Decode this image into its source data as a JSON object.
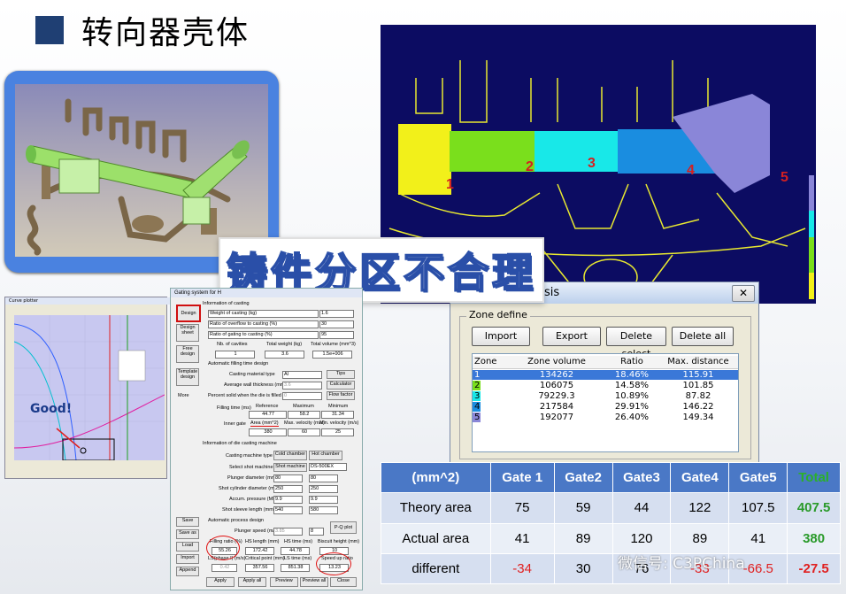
{
  "slide": {
    "title": "转向器壳体",
    "banner": "铸件分区不合理"
  },
  "zone_view": {
    "zone_labels": [
      "1",
      "2",
      "3",
      "4",
      "5"
    ],
    "zone_colors": [
      "#f2f01a",
      "#7adf1c",
      "#18e8e8",
      "#1a8de0",
      "#8a86d8"
    ]
  },
  "zone_dialog": {
    "title_fragment": "sis",
    "group_label": "Zone define",
    "buttons": [
      "Import",
      "Export",
      "Delete select",
      "Delete all"
    ],
    "columns": [
      "Zone",
      "Zone volume",
      "Ratio",
      "Max. distance"
    ],
    "rows": [
      {
        "zone": "1",
        "volume": "134262",
        "ratio": "18.46%",
        "dist": "115.91",
        "color": "#1e6fd6"
      },
      {
        "zone": "2",
        "volume": "106075",
        "ratio": "14.58%",
        "dist": "101.85",
        "color": "#7adf1c"
      },
      {
        "zone": "3",
        "volume": "79229.3",
        "ratio": "10.89%",
        "dist": "87.82",
        "color": "#18e8e8"
      },
      {
        "zone": "4",
        "volume": "217584",
        "ratio": "29.91%",
        "dist": "146.22",
        "color": "#1a8de0"
      },
      {
        "zone": "5",
        "volume": "192077",
        "ratio": "26.40%",
        "dist": "149.34",
        "color": "#8a86d8"
      }
    ]
  },
  "cure_plot": {
    "window_title": "Curve plotter",
    "annotation": "Good!"
  },
  "gating_window": {
    "title": "Gating system for H",
    "side_buttons": [
      "Design",
      "Design sheet",
      "Free design",
      "Template design",
      "More"
    ],
    "bottom_side_buttons": [
      "Save",
      "Save as",
      "Load",
      "Import",
      "Append"
    ],
    "bottom_buttons": [
      "Apply",
      "Apply all",
      "Preview",
      "Preview all",
      "Close"
    ],
    "section_casting": "Information of casting",
    "fields": [
      {
        "label": "Weight of casting (kg)",
        "value": "1.6"
      },
      {
        "label": "Ratio of overflow to casting (%)",
        "value": "30"
      },
      {
        "label": "Ratio of gating to casting (%)",
        "value": "95"
      }
    ],
    "cavities_header": [
      "Nb. of cavities",
      "Total weight (kg)",
      "Total volume (mm^3)"
    ],
    "cavities_values": [
      "1",
      "3.6",
      "1.5e+006"
    ],
    "auto_fill_label": "Automatic filling time design",
    "material_label": "Casting material type",
    "material_value": "Al",
    "tips": "Tips",
    "wall_label": "Average wall thickness (mm)",
    "wall_value": "3.6",
    "calculator": "Calculator",
    "percent_label": "Percent solid when the die is filled (%)",
    "percent_value": "0",
    "flow_factor": "Flow factor",
    "fill_time_label": "Filling time (ms)",
    "fill_cols": [
      "Reference",
      "Maximum",
      "Minimum"
    ],
    "fill_values": [
      "44.77",
      "58.2",
      "31.34"
    ],
    "inner_gate_label": "Inner gate",
    "gate_cols": [
      "Area (mm^2)",
      "Max. velocity (m/s)",
      "Min. velocity (m/s)"
    ],
    "gate_values": [
      "380",
      "60",
      "25"
    ],
    "section_machine": "Information of die casting machine",
    "machine_type_label": "Casting machine type",
    "cold": "Cold chamber",
    "hot": "Hot chamber",
    "select_machine": "Select shot machine",
    "shot_machine": "Shot machine",
    "machine_model": "DS-500EX",
    "plunger_label": "Plunger diameter (mm)",
    "plunger_values": [
      "80",
      "80"
    ],
    "shot_cyl_label": "Shot cylinder diameter (mm)",
    "shot_cyl_values": [
      "250",
      "250"
    ],
    "accum_label": "Accum. pressure (MPa)",
    "accum_values": [
      "9.9",
      "9.9"
    ],
    "sleeve_label": "Shot sleeve length (mm)",
    "sleeve_values": [
      "540",
      "580"
    ],
    "auto_process": "Automatic process design",
    "plunger_speed_label": "Plunger speed (m/s)",
    "plunger_speed_values": [
      "3.85",
      "8"
    ],
    "pq_plot": "P-Q plot",
    "bottom_cols": [
      "Filling ratio (%)",
      "HS length (mm)",
      "HS time (ms)",
      "Biscuit height (mm)"
    ],
    "bottom_values": [
      "55.26",
      "172.42",
      "44.78",
      "10"
    ],
    "bottom_cols2": [
      "LS(phase I) (m/s)",
      "Critical point (mm)",
      "LS time (ms)",
      "Speed up ratio"
    ],
    "bottom_values2": [
      "0.42",
      "357.56",
      "851.38",
      "13.23"
    ]
  },
  "comparison": {
    "header": [
      "(mm^2)",
      "Gate 1",
      "Gate2",
      "Gate3",
      "Gate4",
      "Gate5",
      "Total"
    ],
    "rows": [
      {
        "label": "Theory area",
        "values": [
          "75",
          "59",
          "44",
          "122",
          "107.5",
          "407.5"
        ]
      },
      {
        "label": "Actual area",
        "values": [
          "41",
          "89",
          "120",
          "89",
          "41",
          "380"
        ]
      },
      {
        "label": "different",
        "values": [
          "-34",
          "30",
          "76",
          "-33",
          "-66.5",
          "-27.5"
        ]
      }
    ]
  },
  "watermark": "微信号: C3PChina"
}
